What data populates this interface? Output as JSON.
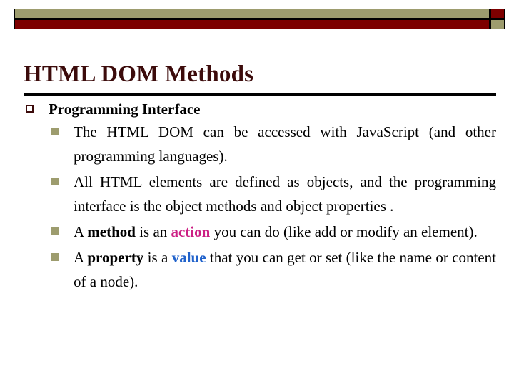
{
  "slide": {
    "title": "HTML DOM Methods",
    "header": {
      "top_bar_color": "#9d9c6e",
      "bottom_bar_color": "#7d0000",
      "top_square_color": "#7d0000",
      "bottom_square_color": "#9d9c6e",
      "border_color": "#000000"
    },
    "colors": {
      "title": "#3c0b0b",
      "bullet_level1_outline": "#3c0b0b",
      "bullet_level2_fill": "#9d9c6e",
      "accent_pink": "#cc1f84",
      "accent_blue": "#2062cb",
      "rule": "#000000",
      "background": "#ffffff"
    },
    "level1": {
      "bullet_glyph": "hollow-square",
      "text": "Programming Interface"
    },
    "level2": [
      {
        "bullet_glyph": "filled-square",
        "segments": [
          {
            "text": "The HTML DOM can be accessed with Java",
            "style": "normal"
          },
          {
            "text": "Script (and other programming languages).",
            "style": "normal"
          }
        ],
        "plain": "The HTML DOM can be accessed with JavaScript (and other programming languages)."
      },
      {
        "bullet_glyph": "filled-square",
        "segments": [
          {
            "text": "All HTML elements are defined as objects, and the programming interface is the object methods and object properties .",
            "style": "normal"
          }
        ],
        "plain": "All HTML elements are defined as objects, and the programming interface is the object methods and object properties ."
      },
      {
        "bullet_glyph": "filled-square",
        "segments": [
          {
            "text": "A ",
            "style": "normal"
          },
          {
            "text": "method",
            "style": "bold"
          },
          {
            "text": " is an ",
            "style": "normal"
          },
          {
            "text": "action",
            "style": "bold-pink"
          },
          {
            "text": " you can do (like add or modify an element).",
            "style": "normal"
          }
        ],
        "plain": "A method is an action you can do (like add or modify an element)."
      },
      {
        "bullet_glyph": "filled-square",
        "segments": [
          {
            "text": "A ",
            "style": "normal"
          },
          {
            "text": "property",
            "style": "bold"
          },
          {
            "text": " is a ",
            "style": "normal"
          },
          {
            "text": "value",
            "style": "bold-blue"
          },
          {
            "text": " that you can get or set (like the name or content of a node).",
            "style": "normal"
          }
        ],
        "plain": "A property is a value that you can get or set (like the name or content of a node)."
      }
    ],
    "bullet_text": {
      "b1_part1": "The HTML DOM can be accessed with JavaScript (and other programming languages).",
      "b2_part1": "All HTML elements are defined as objects, and the programming interface is the object methods and object properties .",
      "b3_a": "A ",
      "b3_method": "method",
      "b3_b": " is an ",
      "b3_action": "action",
      "b3_c": " you can do (like add or modify an element).",
      "b4_a": "A ",
      "b4_property": "property",
      "b4_b": " is a ",
      "b4_value": "value",
      "b4_c": " that you can get or set (like the name or content of a node)."
    }
  }
}
